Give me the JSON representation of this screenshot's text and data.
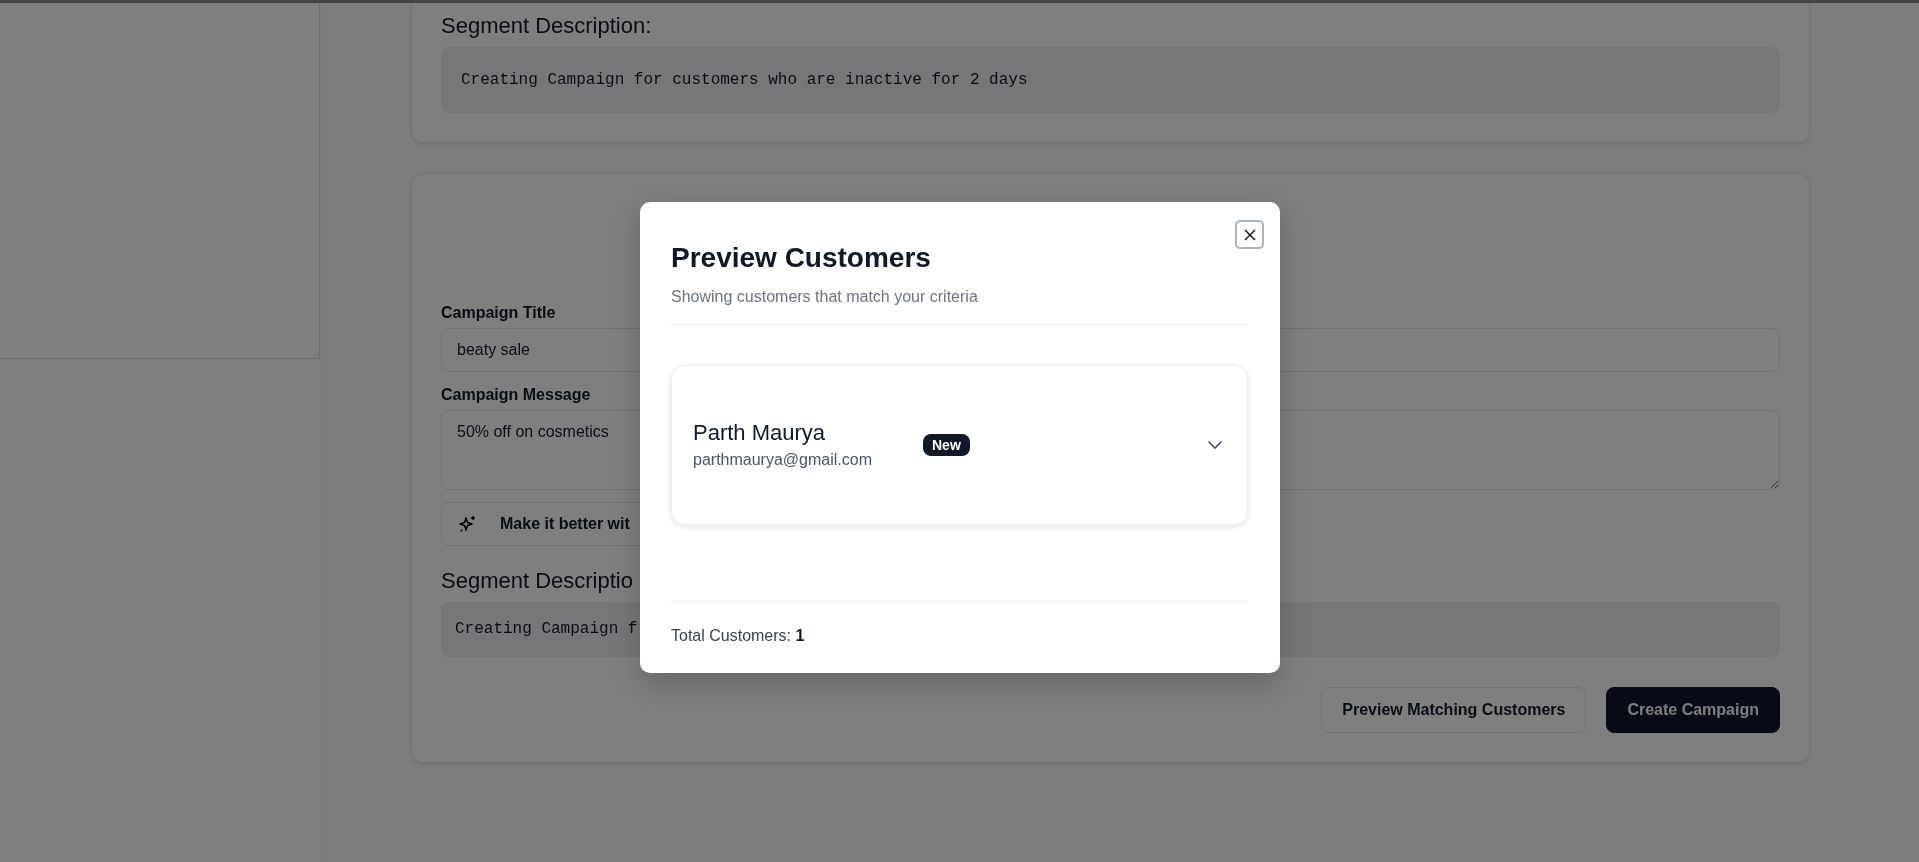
{
  "segment_card": {
    "heading": "Segment Description:",
    "description": "Creating Campaign for customers who are inactive for 2 days"
  },
  "campaign_form": {
    "title_label": "Campaign Title",
    "title_value": "beaty sale",
    "message_label": "Campaign Message",
    "message_value": "50% off on cosmetics",
    "ai_button": "Make it better wit",
    "segment_heading": "Segment Descriptio",
    "segment_text": "Creating Campaign f",
    "buttons": [
      {
        "label": "Preview Matching Customers",
        "kind": "secondary"
      },
      {
        "label": "Create Campaign",
        "kind": "primary"
      }
    ]
  },
  "modal": {
    "title": "Preview Customers",
    "subtitle": "Showing customers that match your criteria",
    "customers": [
      {
        "name": "Parth Maurya",
        "email": "parthmaurya@gmail.com",
        "badge": "New",
        "expanded": false
      }
    ],
    "total": "Total Customers: **1**"
  }
}
